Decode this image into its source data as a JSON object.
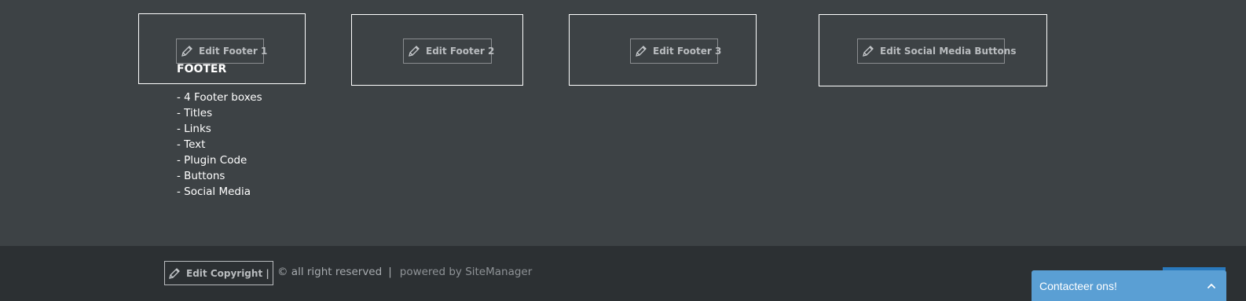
{
  "footer": {
    "edit_buttons": {
      "footer1": "Edit Footer 1",
      "footer2": "Edit Footer 2",
      "footer3": "Edit Footer 3",
      "social": "Edit Social Media Buttons"
    },
    "heading": "FOOTER",
    "items": [
      "- 4 Footer boxes",
      "- Titles",
      "- Links",
      "- Text",
      "- Plugin Code",
      "- Buttons",
      "- Social Media"
    ]
  },
  "bottom_bar": {
    "edit_copyright": "Edit Copyright  |",
    "copyright": "© all right reserved",
    "separator": "|",
    "powered_by": "powered by SiteManager"
  },
  "contact_widget": {
    "label": "Contacteer ons!",
    "icon": "chevron-up-icon"
  },
  "colors": {
    "footer_bg": "#3d4245",
    "bottom_bg": "#2c3033",
    "widget_bg": "#5a9fd4",
    "widget_accent": "#2a79bd"
  }
}
